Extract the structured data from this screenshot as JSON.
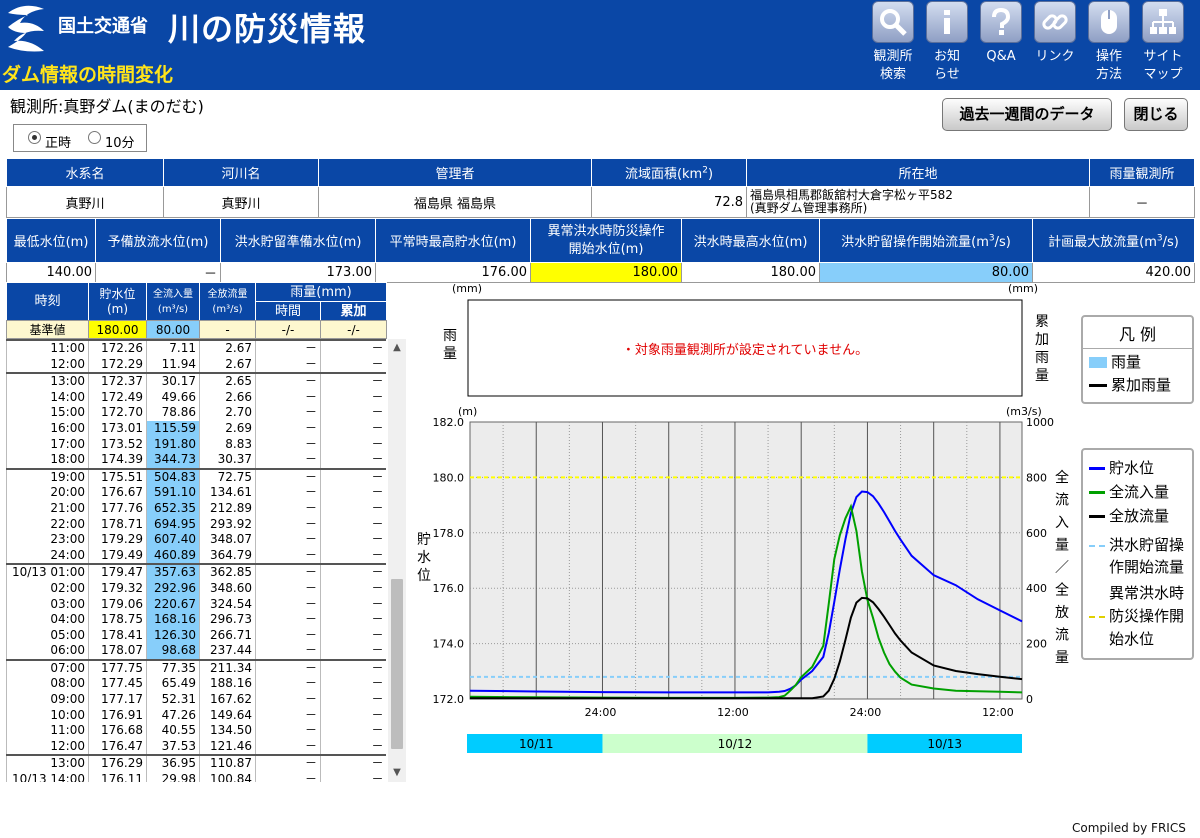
{
  "header": {
    "ministry": "国土交通省",
    "app_title": "川の防災情報",
    "page_heading": "ダム情報の時間変化",
    "nav": [
      {
        "icon": "search-icon",
        "line1": "観測所",
        "line2": "検索"
      },
      {
        "icon": "info-icon",
        "line1": "お知",
        "line2": "らせ"
      },
      {
        "icon": "question-icon",
        "line1": "Q&A",
        "line2": ""
      },
      {
        "icon": "link-icon",
        "line1": "リンク",
        "line2": ""
      },
      {
        "icon": "mouse-icon",
        "line1": "操作",
        "line2": "方法"
      },
      {
        "icon": "sitemap-icon",
        "line1": "サイト",
        "line2": "マップ"
      }
    ]
  },
  "station": {
    "label": "観測所:",
    "name": "真野ダム(まのだむ)"
  },
  "buttons": {
    "week": "過去一週間のデータ",
    "close": "閉じる"
  },
  "radio": {
    "hourly": "正時",
    "tenmin": "10分",
    "selected": "hourly"
  },
  "info1": {
    "headers": {
      "system": "水系名",
      "river": "河川名",
      "manager": "管理者",
      "area": "流域面積(km",
      "area_sup": "2",
      "area_close": ")",
      "location": "所在地",
      "rain_station": "雨量観測所"
    },
    "values": {
      "system": "真野川",
      "river": "真野川",
      "manager": "福島県 福島県",
      "area": "72.8",
      "location1": "福島県相馬郡飯舘村大倉字松ヶ平582",
      "location2": "(真野ダム管理事務所)",
      "rain_station": "－"
    }
  },
  "info2": {
    "headers": {
      "min_level": "最低水位(m)",
      "pre_release": "予備放流水位(m)",
      "flood_prep": "洪水貯留準備水位(m)",
      "normal_max": "平常時最高貯水位(m)",
      "abnormal1": "異常洪水時防災操作",
      "abnormal2": "開始水位(m)",
      "flood_max": "洪水時最高水位(m)",
      "flood_flow_pre": "洪水貯留操作開始流量(m",
      "flood_flow_sup": "3",
      "flood_flow_post": "/s)",
      "plan_max_pre": "計画最大放流量(m",
      "plan_max_sup": "3",
      "plan_max_post": "/s)"
    },
    "values": {
      "min_level": "140.00",
      "pre_release": "－",
      "flood_prep": "173.00",
      "normal_max": "176.00",
      "abnormal": "180.00",
      "flood_max": "180.00",
      "flood_flow": "80.00",
      "plan_max": "420.00"
    }
  },
  "timeseries": {
    "headers": {
      "time": "時刻",
      "level1": "貯水位",
      "level2": "(m)",
      "inflow1": "全流入量",
      "inflow2": "(m³/s)",
      "outflow1": "全放流量",
      "outflow2": "(m³/s)",
      "rain": "雨量(mm)",
      "rain_hour": "時間",
      "rain_cum": "累加"
    },
    "base": {
      "label": "基準値",
      "level": "180.00",
      "inflow": "80.00",
      "outflow": "-",
      "rain_hour": "-/-",
      "rain_cum": "-/-"
    },
    "groups": [
      [
        {
          "t": "11:00",
          "lv": "172.26",
          "in": "7.11",
          "out": "2.67",
          "rh": "－",
          "rc": "－"
        },
        {
          "t": "12:00",
          "lv": "172.29",
          "in": "11.94",
          "out": "2.67",
          "rh": "－",
          "rc": "－"
        }
      ],
      [
        {
          "t": "13:00",
          "lv": "172.37",
          "in": "30.17",
          "out": "2.65",
          "rh": "－",
          "rc": "－"
        },
        {
          "t": "14:00",
          "lv": "172.49",
          "in": "49.66",
          "out": "2.66",
          "rh": "－",
          "rc": "－"
        },
        {
          "t": "15:00",
          "lv": "172.70",
          "in": "78.86",
          "out": "2.70",
          "rh": "－",
          "rc": "－"
        },
        {
          "t": "16:00",
          "lv": "173.01",
          "in": "115.59",
          "out": "2.69",
          "rh": "－",
          "rc": "－",
          "hi": true
        },
        {
          "t": "17:00",
          "lv": "173.52",
          "in": "191.80",
          "out": "8.83",
          "rh": "－",
          "rc": "－",
          "hi": true
        },
        {
          "t": "18:00",
          "lv": "174.39",
          "in": "344.73",
          "out": "30.37",
          "rh": "－",
          "rc": "－",
          "hi": true
        }
      ],
      [
        {
          "t": "19:00",
          "lv": "175.51",
          "in": "504.83",
          "out": "72.75",
          "rh": "－",
          "rc": "－",
          "hi": true
        },
        {
          "t": "20:00",
          "lv": "176.67",
          "in": "591.10",
          "out": "134.61",
          "rh": "－",
          "rc": "－",
          "hi": true
        },
        {
          "t": "21:00",
          "lv": "177.76",
          "in": "652.35",
          "out": "212.89",
          "rh": "－",
          "rc": "－",
          "hi": true
        },
        {
          "t": "22:00",
          "lv": "178.71",
          "in": "694.95",
          "out": "293.92",
          "rh": "－",
          "rc": "－",
          "hi": true
        },
        {
          "t": "23:00",
          "lv": "179.29",
          "in": "607.40",
          "out": "348.07",
          "rh": "－",
          "rc": "－",
          "hi": true
        },
        {
          "t": "24:00",
          "lv": "179.49",
          "in": "460.89",
          "out": "364.79",
          "rh": "－",
          "rc": "－",
          "hi": true
        }
      ],
      [
        {
          "t": "10/13 01:00",
          "lv": "179.47",
          "in": "357.63",
          "out": "362.85",
          "rh": "－",
          "rc": "－",
          "hi": true
        },
        {
          "t": "02:00",
          "lv": "179.32",
          "in": "292.96",
          "out": "348.60",
          "rh": "－",
          "rc": "－",
          "hi": true
        },
        {
          "t": "03:00",
          "lv": "179.06",
          "in": "220.67",
          "out": "324.54",
          "rh": "－",
          "rc": "－",
          "hi": true
        },
        {
          "t": "04:00",
          "lv": "178.75",
          "in": "168.16",
          "out": "296.73",
          "rh": "－",
          "rc": "－",
          "hi": true
        },
        {
          "t": "05:00",
          "lv": "178.41",
          "in": "126.30",
          "out": "266.71",
          "rh": "－",
          "rc": "－",
          "hi": true
        },
        {
          "t": "06:00",
          "lv": "178.07",
          "in": "98.68",
          "out": "237.44",
          "rh": "－",
          "rc": "－",
          "hi": true
        }
      ],
      [
        {
          "t": "07:00",
          "lv": "177.75",
          "in": "77.35",
          "out": "211.34",
          "rh": "－",
          "rc": "－"
        },
        {
          "t": "08:00",
          "lv": "177.45",
          "in": "65.49",
          "out": "188.16",
          "rh": "－",
          "rc": "－"
        },
        {
          "t": "09:00",
          "lv": "177.17",
          "in": "52.31",
          "out": "167.62",
          "rh": "－",
          "rc": "－"
        },
        {
          "t": "10:00",
          "lv": "176.91",
          "in": "47.26",
          "out": "149.64",
          "rh": "－",
          "rc": "－"
        },
        {
          "t": "11:00",
          "lv": "176.68",
          "in": "40.55",
          "out": "134.50",
          "rh": "－",
          "rc": "－"
        },
        {
          "t": "12:00",
          "lv": "176.47",
          "in": "37.53",
          "out": "121.46",
          "rh": "－",
          "rc": "－"
        }
      ],
      [
        {
          "t": "13:00",
          "lv": "176.29",
          "in": "36.95",
          "out": "110.87",
          "rh": "－",
          "rc": "－"
        },
        {
          "t": "10/13 14:00",
          "lv": "176.11",
          "in": "29.98",
          "out": "100.84",
          "rh": "－",
          "rc": "－"
        }
      ]
    ]
  },
  "chart_data": {
    "type": "line",
    "rain_panel": {
      "left_unit": "(mm)",
      "right_unit": "(mm)",
      "left_label": "雨量",
      "right_label": "累加雨量",
      "message": "・対象雨量観測所が設定されていません。"
    },
    "left_axis": {
      "unit": "(m)",
      "label": "貯水位",
      "ylim": [
        172,
        182
      ],
      "ticks": [
        "182.0",
        "180.0",
        "178.0",
        "176.0",
        "174.0",
        "172.0"
      ]
    },
    "right_axis": {
      "unit": "(m3/s)",
      "label": "全流入量／全放流量",
      "ylim": [
        0,
        1000
      ],
      "ticks": [
        "1000",
        "800",
        "600",
        "400",
        "200",
        "0"
      ]
    },
    "x_ticks": [
      "24:00",
      "12:00",
      "24:00",
      "12:00"
    ],
    "date_bands": [
      {
        "label": "10/11",
        "color": "#00ccff"
      },
      {
        "label": "10/12",
        "color": "#ccffcc"
      },
      {
        "label": "10/13",
        "color": "#00ccff"
      }
    ],
    "x_hours": [
      0,
      12,
      24,
      36,
      48,
      54,
      56,
      57,
      58,
      59,
      60,
      62,
      64,
      65,
      66,
      67,
      68,
      69,
      70,
      71,
      72,
      73,
      74,
      75,
      76,
      77,
      78,
      80,
      84,
      88,
      92,
      96,
      100
    ],
    "series": [
      {
        "name": "貯水位",
        "color": "#0000ff",
        "axis": "left",
        "values": [
          172.3,
          172.27,
          172.25,
          172.24,
          172.24,
          172.24,
          172.26,
          172.29,
          172.37,
          172.49,
          172.7,
          173.01,
          173.52,
          174.39,
          175.51,
          176.67,
          177.76,
          178.71,
          179.29,
          179.49,
          179.47,
          179.32,
          179.06,
          178.75,
          178.41,
          178.07,
          177.75,
          177.17,
          176.47,
          176.11,
          175.6,
          175.2,
          174.8
        ]
      },
      {
        "name": "全流入量",
        "color": "#00a000",
        "axis": "right",
        "values": [
          8,
          6,
          5,
          4,
          4,
          5,
          7,
          12,
          30,
          50,
          79,
          116,
          192,
          345,
          505,
          591,
          652,
          695,
          607,
          461,
          358,
          293,
          221,
          168,
          126,
          99,
          77,
          52,
          38,
          30,
          28,
          26,
          24
        ]
      },
      {
        "name": "全放流量",
        "color": "#000000",
        "axis": "right",
        "values": [
          3,
          3,
          3,
          3,
          3,
          3,
          3,
          3,
          3,
          3,
          3,
          3,
          9,
          30,
          73,
          135,
          213,
          294,
          348,
          365,
          363,
          349,
          325,
          297,
          267,
          237,
          211,
          168,
          121,
          101,
          90,
          80,
          72
        ]
      }
    ],
    "reference_lines": [
      {
        "name": "洪水貯留操作開始流量",
        "axis": "right",
        "value": 80,
        "color": "#87cefa",
        "style": "dashed"
      },
      {
        "name": "異常洪水時防災操作開始水位",
        "axis": "left",
        "value": 180,
        "color": "#ffff00",
        "style": "dashed"
      }
    ],
    "legend_rain": {
      "title": "凡 例",
      "items": [
        "雨量",
        "累加雨量"
      ]
    },
    "legend_main": {
      "items": [
        "貯水位",
        "全流入量",
        "全放流量",
        "洪水貯留操",
        "作開始流量",
        "異常洪水時",
        "防災操作開",
        "始水位"
      ]
    }
  },
  "footer": {
    "compiled": "Compiled by FRICS"
  }
}
